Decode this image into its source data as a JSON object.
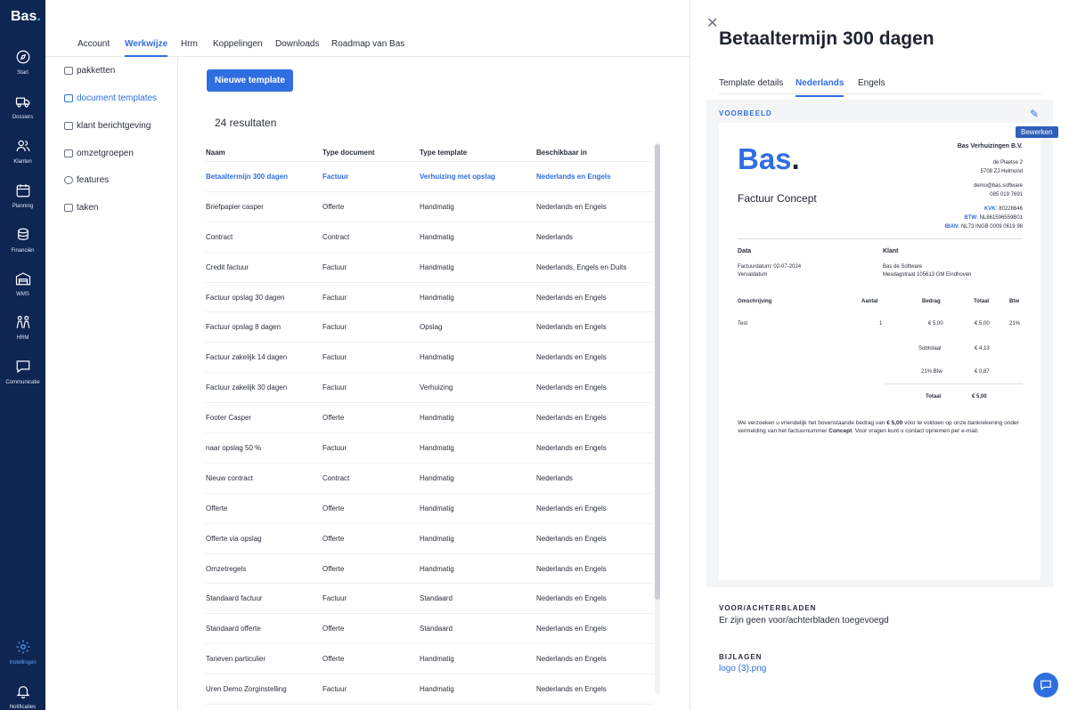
{
  "app": {
    "logo_text": "Bas",
    "logo_dot": "."
  },
  "nav": {
    "items": [
      {
        "label": "Start",
        "icon": "compass-icon"
      },
      {
        "label": "Dossiers",
        "icon": "truck-icon"
      },
      {
        "label": "Klanten",
        "icon": "users-icon"
      },
      {
        "label": "Planning",
        "icon": "calendar-icon"
      },
      {
        "label": "Financiën",
        "icon": "coins-icon"
      },
      {
        "label": "WMS",
        "icon": "warehouse-icon"
      },
      {
        "label": "HRM",
        "icon": "people-icon"
      },
      {
        "label": "Communicatie",
        "icon": "chat-icon"
      },
      {
        "label": "Instellingen",
        "icon": "gear-icon"
      },
      {
        "label": "Notificaties",
        "icon": "bell-icon"
      }
    ]
  },
  "tabs": [
    "Account",
    "Werkwijze",
    "Hrm",
    "Koppelingen",
    "Downloads",
    "Roadmap van Bas"
  ],
  "active_tab": "Werkwijze",
  "submenu": [
    "pakketten",
    "document templates",
    "klant berichtgeving",
    "omzetgroepen",
    "features",
    "taken"
  ],
  "main": {
    "new_button": "Nieuwe template",
    "results": "24 resultaten",
    "columns": [
      "Naam",
      "Type document",
      "Type template",
      "Beschikbaar in"
    ],
    "rows": [
      [
        "Betaaltermijn 300 dagen",
        "Factuur",
        "Verhuizing met opslag",
        "Nederlands en Engels"
      ],
      [
        "Briefpapier casper",
        "Offerte",
        "Handmatig",
        "Nederlands en Engels"
      ],
      [
        "Contract",
        "Contract",
        "Handmatig",
        "Nederlands"
      ],
      [
        "Credit factuur",
        "Factuur",
        "Handmatig",
        "Nederlands, Engels en Duits"
      ],
      [
        "Factuur opslag 30 dagen",
        "Factuur",
        "Handmatig",
        "Nederlands en Engels"
      ],
      [
        "Factuur opslag 8 dagen",
        "Factuur",
        "Opslag",
        "Nederlands en Engels"
      ],
      [
        "Factuur zakelijk 14 dagen",
        "Factuur",
        "Handmatig",
        "Nederlands en Engels"
      ],
      [
        "Factuur zakelijk 30 dagen",
        "Factuur",
        "Verhuizing",
        "Nederlands en Engels"
      ],
      [
        "Footer Casper",
        "Offerte",
        "Handmatig",
        "Nederlands en Engels"
      ],
      [
        "naar opslag 50 %",
        "Factuur",
        "Handmatig",
        "Nederlands en Engels"
      ],
      [
        "Nieuw contract",
        "Contract",
        "Handmatig",
        "Nederlands"
      ],
      [
        "Offerte",
        "Offerte",
        "Handmatig",
        "Nederlands en Engels"
      ],
      [
        "Offerte via opslag",
        "Offerte",
        "Handmatig",
        "Nederlands en Engels"
      ],
      [
        "Omzetregels",
        "Offerte",
        "Handmatig",
        "Nederlands en Engels"
      ],
      [
        "Standaard factuur",
        "Factuur",
        "Standaard",
        "Nederlands en Engels"
      ],
      [
        "Standaard offerte",
        "Offerte",
        "Standaard",
        "Nederlands en Engels"
      ],
      [
        "Tarieven particulier",
        "Offerte",
        "Handmatig",
        "Nederlands en Engels"
      ],
      [
        "Uren Demo Zorginstelling",
        "Factuur",
        "Handmatig",
        "Nederlands en Engels"
      ]
    ]
  },
  "panel": {
    "title": "Betaaltermijn 300 dagen",
    "tabs": [
      "Template details",
      "Nederlands",
      "Engels"
    ],
    "preview_label": "VOORBEELD",
    "edit_tooltip": "Bewerken",
    "doc": {
      "logo": "Bas",
      "logo_dot": ".",
      "concept": "Factuur Concept",
      "company_name": "Bas Verhuizingen B.V.",
      "address1": "de Plaetse 2",
      "address2": "5708 ZJ Helmond",
      "email": "demo@bas.software",
      "phone": "085 019 7691",
      "kvk_label": "KVK:",
      "kvk": "80228646",
      "btw_label": "BTW:",
      "btw": "NL861596559B01",
      "iban_label": "IBAN:",
      "iban": "NL73 INGB 0009 0619 98",
      "data_label": "Data",
      "klant_label": "Klant",
      "invoice_date": "Factuurdatum: 02-07-2024",
      "due_date": "Vervaldatum",
      "client_name": "Bas de Software",
      "client_address": "Mesdagstraat 105613 GM Eindhoven",
      "col_desc": "Omschrijving",
      "col_qty": "Aantal",
      "col_amount": "Bedrag",
      "col_total": "Totaal",
      "col_btw": "Btw",
      "item_desc": "Test",
      "item_qty": "1",
      "item_amount": "€ 5,00",
      "item_total": "€ 5,00",
      "item_btw": "21%",
      "subtotal_label": "Subtotaal",
      "subtotal": "€ 4,13",
      "vat_label": "21% Btw",
      "vat": "€ 0,87",
      "total_label": "Totaal",
      "total": "€ 5,00",
      "closing_1": "We verzoeken u vriendelijk het bovenstaande bedrag van ",
      "closing_amount": "€ 5,00",
      "closing_2": " voor te voldoen op onze bankrekening onder vermelding van het factuurnummer ",
      "closing_concept": "Concept",
      "closing_3": ". Voor vragen kunt u contact opnemen per e-mail."
    },
    "pages_heading": "VOOR/ACHTERBLADEN",
    "pages_text": "Er zijn geen voor/achterbladen toegevoegd",
    "attachments_heading": "BIJLAGEN",
    "attachment": "logo (3).png"
  }
}
